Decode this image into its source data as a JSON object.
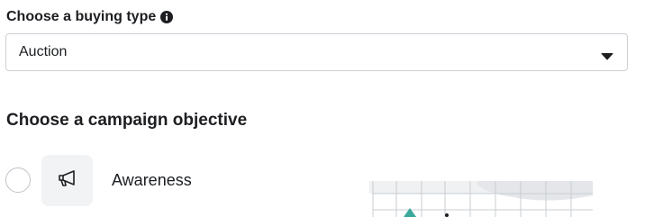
{
  "buying_type": {
    "label": "Choose a buying type",
    "info_icon": "info-icon",
    "selected_value": "Auction",
    "caret_icon": "caret-down-icon"
  },
  "campaign_objective": {
    "heading": "Choose a campaign objective",
    "options": [
      {
        "label": "Awareness",
        "icon": "megaphone-icon",
        "selected": false
      }
    ]
  },
  "colors": {
    "text": "#1c1e21",
    "border": "#ccd0d5",
    "tile_bg": "#f2f3f5",
    "preview_accent": "#3aa89a"
  }
}
